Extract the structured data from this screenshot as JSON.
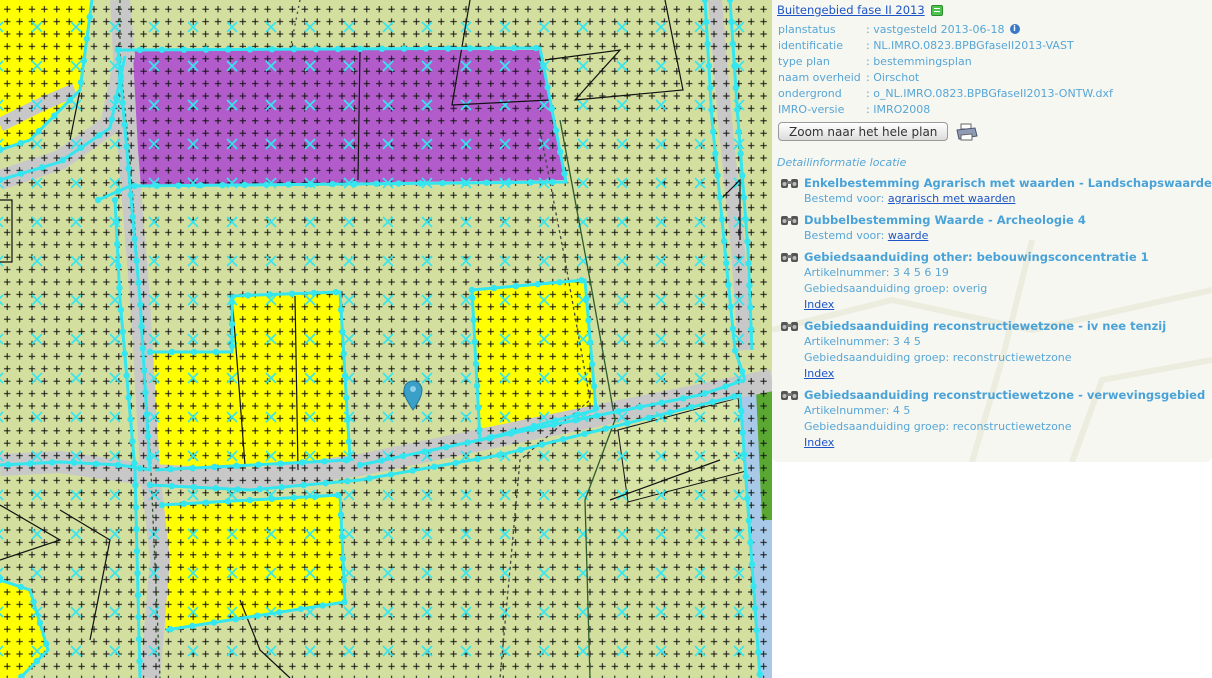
{
  "plan": {
    "title": "Buitengebied fase II 2013",
    "meta": [
      {
        "key": "planstatus",
        "value": ": vastgesteld 2013-06-18",
        "has_info_icon": true
      },
      {
        "key": "identificatie",
        "value": ": NL.IMRO.0823.BPBGfaseII2013-VAST"
      },
      {
        "key": "type plan",
        "value": ": bestemmingsplan"
      },
      {
        "key": "naam overheid",
        "value": ": Oirschot"
      },
      {
        "key": "ondergrond",
        "value": ": o_NL.IMRO.0823.BPBGfaseII2013-ONTW.dxf"
      },
      {
        "key": "IMRO-versie",
        "value": ": IMRO2008"
      }
    ],
    "zoom_button": "Zoom naar het hele plan",
    "icons": {
      "document": "document-icon",
      "info": "info-icon",
      "print": "printer-icon",
      "detail": "binoculars-icon",
      "marker": "location-marker-icon"
    }
  },
  "details_label": "Detailinformatie locatie",
  "details": [
    {
      "title": "Enkelbestemming Agrarisch met waarden - Landschapswaarden",
      "lines": [
        {
          "prefix": "Bestemd voor: ",
          "link": "agrarisch met waarden"
        }
      ]
    },
    {
      "title": "Dubbelbestemming Waarde - Archeologie 4",
      "lines": [
        {
          "prefix": "Bestemd voor: ",
          "link": "waarde"
        }
      ]
    },
    {
      "title": "Gebiedsaanduiding other: bebouwingsconcentratie 1",
      "lines": [
        {
          "prefix": "Artikelnummer: 3 4 5 6 19"
        },
        {
          "prefix": "Gebiedsaanduiding groep: overig"
        }
      ],
      "index": "Index"
    },
    {
      "title": "Gebiedsaanduiding reconstructiewetzone - iv nee tenzij",
      "lines": [
        {
          "prefix": "Artikelnummer: 3 4 5"
        },
        {
          "prefix": "Gebiedsaanduiding groep: reconstructiewetzone"
        }
      ],
      "index": "Index"
    },
    {
      "title": "Gebiedsaanduiding reconstructiewetzone - verwevingsgebied",
      "lines": [
        {
          "prefix": "Artikelnummer: 4 5"
        },
        {
          "prefix": "Gebiedsaanduiding groep: reconstructiewetzone"
        }
      ],
      "index": "Index"
    }
  ],
  "map_colors": {
    "agrarisch": "#d3df9f",
    "wonen": "#ffff00",
    "bedrijf": "#b25ccc",
    "verkeer": "#c8c8c8",
    "grens": "#33e6ef",
    "water": "#a9c9e8",
    "bos": "#5aa832"
  }
}
